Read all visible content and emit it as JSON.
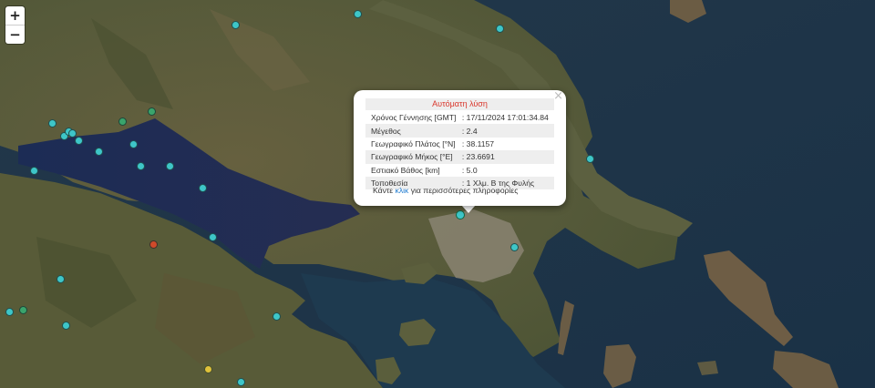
{
  "zoom": {
    "in_label": "+",
    "out_label": "−"
  },
  "popup": {
    "title": "Αυτόματη λύση",
    "close_label": "×",
    "rows": [
      {
        "label": "Χρόνος Γέννησης [GMT]",
        "value": ": 17/11/2024 17:01:34.84"
      },
      {
        "label": "Μέγεθος",
        "value": ": 2.4"
      },
      {
        "label": "Γεωγραφικό Πλάτος [°N]",
        "value": ": 38.1157"
      },
      {
        "label": "Γεωγραφικό Μήκος [°E]",
        "value": ": 23.6691"
      },
      {
        "label": "Εστιακό Βάθος [km]",
        "value": ": 5.0"
      },
      {
        "label": "Τοποθεσία",
        "value": ": 1 Χλμ. Β της Φυλής"
      }
    ],
    "more_prefix": "Κάντε ",
    "more_link": "κλικ",
    "more_suffix": " για περισσότερες πληροφορίες"
  },
  "colors": {
    "marker_cyan": "#3ec6c8",
    "marker_green": "#3aa46c",
    "marker_red": "#d04a2a",
    "marker_yellow": "#e0c23a",
    "sea": "#1f3a4e",
    "gulf": "#1c2a55",
    "land": "#5b5d3c",
    "popup_title": "#d9362b",
    "link": "#1f7bd0"
  }
}
